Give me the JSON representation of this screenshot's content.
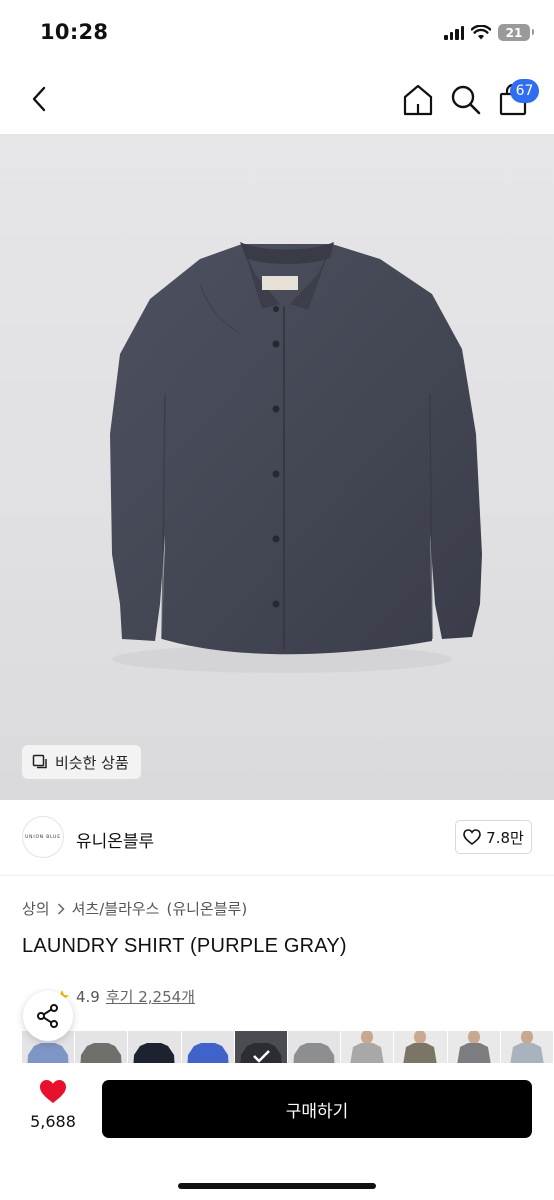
{
  "status_bar": {
    "time": "10:28",
    "battery": "21"
  },
  "nav": {
    "cart_count": "67",
    "back_icon": "chevron-left-icon",
    "home_icon": "home-icon",
    "search_icon": "search-icon",
    "cart_icon": "shopping-bag-icon"
  },
  "hero": {
    "similar_label": "비슷한 상품"
  },
  "brand": {
    "logo_text": "UNION BLUE",
    "name": "유니온블루",
    "like_count": "7.8만"
  },
  "breadcrumb": [
    "상의",
    "셔츠/블라우스",
    "(유니온블루)"
  ],
  "product": {
    "title": "LAUNDRY SHIRT (PURPLE GRAY)",
    "rating": "4.9",
    "review_label": "후기 2,254개"
  },
  "thumbnails": [
    {
      "color": "#7f95c4",
      "type": "shirt"
    },
    {
      "color": "#6f706c",
      "type": "shirt"
    },
    {
      "color": "#1d2230",
      "type": "shirt"
    },
    {
      "color": "#3f63c8",
      "type": "shirt"
    },
    {
      "color": "#33373d",
      "type": "selected"
    },
    {
      "color": "#8d8e90",
      "type": "shirt"
    },
    {
      "color": "#a8a9a6",
      "type": "model"
    },
    {
      "color": "#7a7565",
      "type": "model"
    },
    {
      "color": "#7b7d80",
      "type": "model"
    },
    {
      "color": "#a9b3bd",
      "type": "model"
    }
  ],
  "bottom": {
    "like_count": "5,688",
    "buy_label": "구매하기"
  },
  "colors": {
    "accent_badge": "#2f6ef0",
    "heart": "#e8112d",
    "buy_button": "#000000",
    "shirt": "#474a57"
  }
}
